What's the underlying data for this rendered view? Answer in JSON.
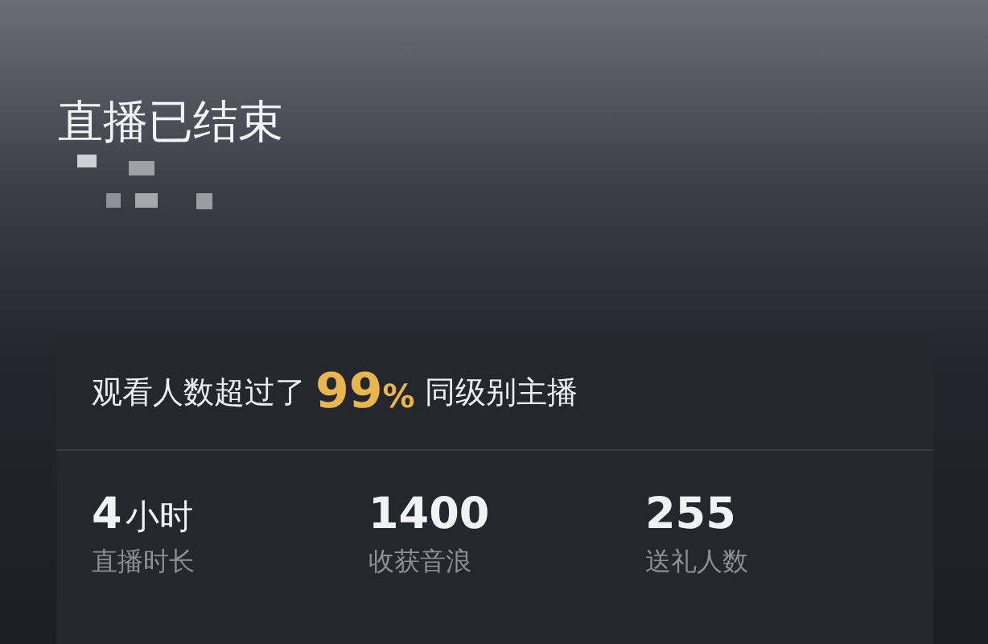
{
  "title": "直播已结束",
  "summary": {
    "prefix": "观看人数超过了",
    "highlight": "99",
    "unit": "%",
    "suffix": "同级别主播"
  },
  "stats": [
    {
      "value": "4",
      "unit": "小时",
      "label": "直播时长"
    },
    {
      "value": "1400",
      "label": "收获音浪"
    },
    {
      "value": "255",
      "label": "送礼人数"
    }
  ]
}
